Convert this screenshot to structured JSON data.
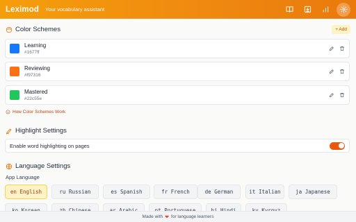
{
  "header": {
    "logo": "Leximod",
    "tagline": "Your vocabulary assistant",
    "icons": [
      "book-icon",
      "import-icon",
      "stats-icon",
      "settings-icon"
    ]
  },
  "color_schemes": {
    "title": "Color Schemes",
    "add_label": "+ Add",
    "items": [
      {
        "name": "Learning",
        "hex": "#1677ff"
      },
      {
        "name": "Reviewing",
        "hex": "#f97316"
      },
      {
        "name": "Mastered",
        "hex": "#22c55e"
      }
    ],
    "help_link": "How Color Schemes Work"
  },
  "highlight": {
    "title": "Highlight Settings",
    "toggle_label": "Enable word highlighting on pages",
    "enabled": true
  },
  "language": {
    "title": "Language Settings",
    "app_language_label": "App Language",
    "selected": "en",
    "options": [
      {
        "code": "en",
        "label": "English"
      },
      {
        "code": "ru",
        "label": "Russian"
      },
      {
        "code": "es",
        "label": "Spanish"
      },
      {
        "code": "fr",
        "label": "French"
      },
      {
        "code": "de",
        "label": "German"
      },
      {
        "code": "it",
        "label": "Italian"
      },
      {
        "code": "ja",
        "label": "Japanese"
      },
      {
        "code": "ko",
        "label": "Korean"
      },
      {
        "code": "zh",
        "label": "Chinese"
      },
      {
        "code": "ar",
        "label": "Arabic"
      },
      {
        "code": "pt",
        "label": "Portuguese"
      },
      {
        "code": "hi",
        "label": "Hindi"
      },
      {
        "code": "ky",
        "label": "Kyrgyz"
      }
    ]
  },
  "footer": {
    "pre": "Made with",
    "post": "for language learners"
  }
}
